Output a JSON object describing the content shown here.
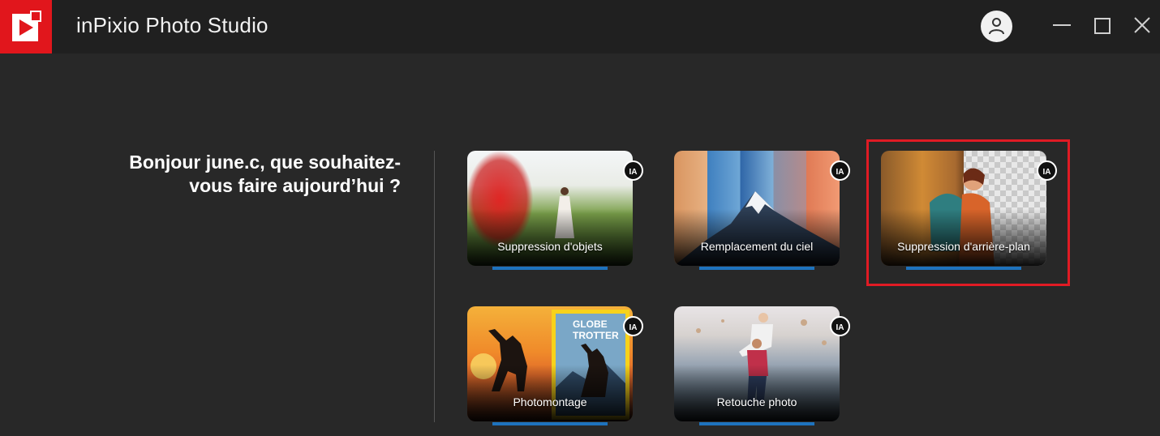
{
  "app": {
    "title": "inPixio Photo Studio",
    "accent_color": "#e1161c",
    "logo_icon": "play-logo-icon"
  },
  "header": {
    "account_icon": "user-icon",
    "controls": [
      "minimize-icon",
      "maximize-icon",
      "close-icon"
    ]
  },
  "greeting": "Bonjour june.c, que souhaitez-vous faire aujourd’hui ?",
  "cards": [
    {
      "label": "Suppression d'objets",
      "badge": "IA"
    },
    {
      "label": "Remplacement du ciel",
      "badge": "IA"
    },
    {
      "label": "Suppression d'arrière-plan",
      "badge": "IA"
    },
    {
      "label": "Photomontage",
      "badge": "IA",
      "magazine_text": "GLOBE TROTTER"
    },
    {
      "label": "Retouche photo",
      "badge": "IA"
    }
  ],
  "colors": {
    "card_bar": "#1e73be",
    "highlight_border": "#e01b24"
  }
}
